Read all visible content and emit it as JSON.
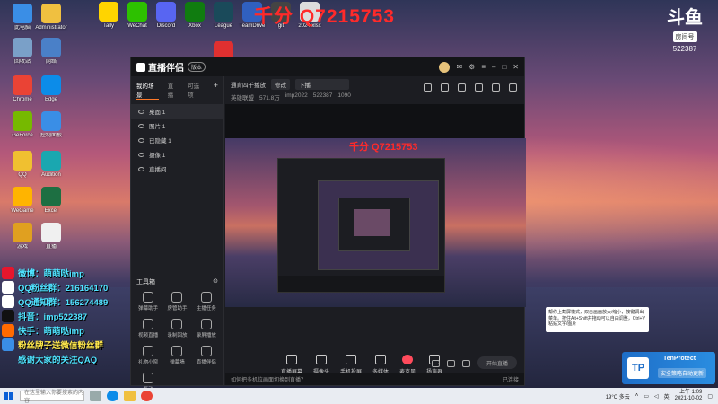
{
  "desktop": {
    "watermark": "千分 Q7215753",
    "icons": [
      {
        "label": "此电脑",
        "icon": "computer-icon",
        "color": "#3a8ee6"
      },
      {
        "label": "Administrator",
        "icon": "user-folder-icon",
        "color": "#f0c040"
      },
      {
        "label": "Tally",
        "icon": "tally-icon",
        "color": "#ffd400"
      },
      {
        "label": "WeChat",
        "icon": "wechat-icon",
        "color": "#2dc100"
      },
      {
        "label": "Discord",
        "icon": "discord-icon",
        "color": "#5865f2"
      },
      {
        "label": "Xbox",
        "icon": "xbox-icon",
        "color": "#107c10"
      },
      {
        "label": "League",
        "icon": "league-icon",
        "color": "#1a4a5a"
      },
      {
        "label": "TeamDrive",
        "icon": "app-icon",
        "color": "#3060c0"
      },
      {
        "label": "git",
        "icon": "app-icon",
        "color": "#444"
      },
      {
        "label": "2024.xlsx",
        "icon": "file-icon",
        "color": "#ddd"
      },
      {
        "label": "回收站",
        "icon": "recycle-bin-icon",
        "color": "#7aa0c8"
      },
      {
        "label": "网络",
        "icon": "network-icon",
        "color": "#4a80c8"
      },
      {
        "label": "PDF",
        "icon": "pdf-icon",
        "color": "#e03030"
      },
      {
        "label": "Chrome",
        "icon": "chrome-icon",
        "color": "#ea4335"
      },
      {
        "label": "Edge",
        "icon": "edge-icon",
        "color": "#0c8ce9"
      },
      {
        "label": "GeForce",
        "icon": "nvidia-icon",
        "color": "#76b900"
      },
      {
        "label": "控制面板",
        "icon": "control-panel-icon",
        "color": "#3a8ee6"
      },
      {
        "label": "QQ",
        "icon": "qq-icon",
        "color": "#f0c030"
      },
      {
        "label": "Audition",
        "icon": "audio-icon",
        "color": "#1aa7b0"
      },
      {
        "label": "WeGame",
        "icon": "wegame-icon",
        "color": "#ffb400"
      },
      {
        "label": "Excel",
        "icon": "excel-icon",
        "color": "#1d6f42"
      },
      {
        "label": "游戏",
        "icon": "game-icon",
        "color": "#e0a020"
      },
      {
        "label": "直播",
        "icon": "app-icon",
        "color": "#f0f0f0"
      }
    ]
  },
  "room": {
    "logo": "斗鱼",
    "tag": "房间号",
    "number": "522387"
  },
  "overlay": [
    {
      "text": "微博：萌萌哒imp",
      "style": "cyan",
      "icon": "weibo-icon",
      "color": "#e6162d"
    },
    {
      "text": "QQ粉丝群：216164170",
      "style": "cyan",
      "icon": "qq-group-icon",
      "color": "#fff"
    },
    {
      "text": "QQ通知群：156274489",
      "style": "cyan",
      "icon": "qq-group-icon",
      "color": "#fff"
    },
    {
      "text": "抖音：imp522387",
      "style": "cyan",
      "icon": "douyin-icon",
      "color": "#111"
    },
    {
      "text": "快手：萌萌哒imp",
      "style": "cyan",
      "icon": "kuaishou-icon",
      "color": "#ff6a00"
    },
    {
      "text": "粉丝牌子送微信粉丝群",
      "style": "yellow",
      "icon": "badge-icon",
      "color": "#3a8ee6"
    },
    {
      "text": "感谢大家的关注QAQ",
      "style": "cyan",
      "icon": "",
      "color": ""
    }
  ],
  "app": {
    "brand": "直播伴侣",
    "badge": "版本",
    "sidebar": {
      "tabs": [
        "我的场景",
        "直播",
        "可选项"
      ],
      "scenes": [
        "桌面 1",
        "图片 1",
        "已隐藏 1",
        "摄像 1",
        "直播间"
      ],
      "tools_title": "工具箱",
      "tools": [
        "弹幕助手",
        "房管助手",
        "主播任务",
        "视频直播",
        "录制回放",
        "录屏播放",
        "礼物小窗",
        "弹幕墙",
        "直播伴侣",
        "互动"
      ]
    },
    "topinfo": {
      "title": "通宵四千播放",
      "btn_edit": "修改",
      "category": "下播",
      "stat1": "英雄联盟",
      "stat2": "571.8万",
      "user": "imp2022",
      "room_no": "522387",
      "fans": "1090"
    },
    "tooltip": "帮你上截屏模式，双击画面放大/缩小，按键调出菜单。按住Alt+Shift并拖动可以自由调整，Ctrl+V粘贴文字/图片",
    "controls": [
      "直播屏幕",
      "摄像头",
      "手机投屏",
      "多媒体",
      "麦克风",
      "扬声器"
    ],
    "start_label": "开始直播",
    "footer_left": "如何把多机位画面切换到直播？",
    "footer_right": "已连接"
  },
  "tenprotect": {
    "title": "TenProtect",
    "message": "安全策略自动更新"
  },
  "taskbar": {
    "search_placeholder": "在这里输入你要搜索的内容",
    "weather": "19°C 多云",
    "lang": "英",
    "time": "上午 1:09",
    "date": "2021-10-02"
  }
}
